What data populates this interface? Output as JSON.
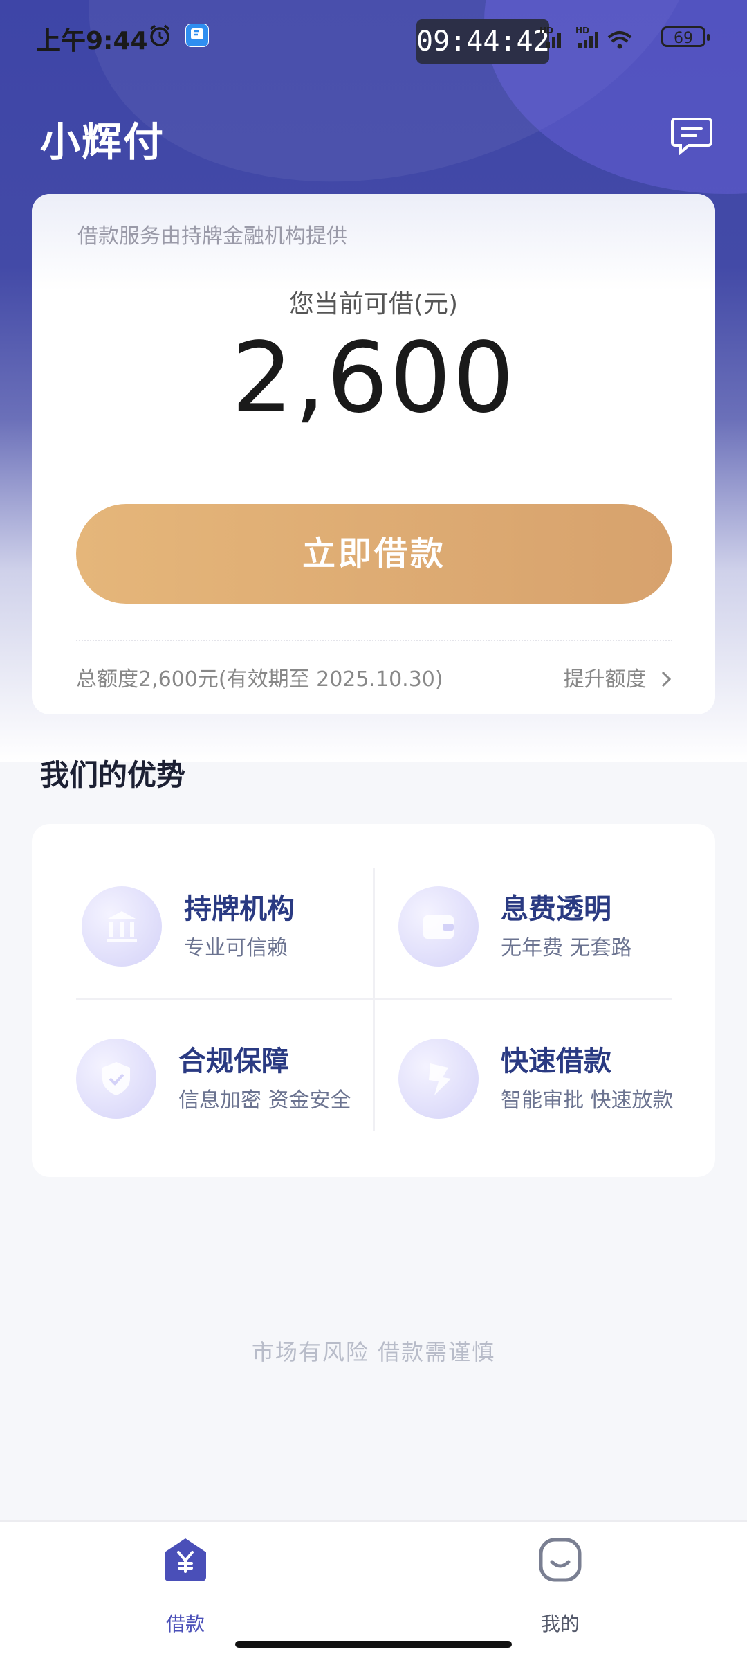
{
  "status_bar": {
    "time": "上午9:44",
    "clock_overlay": "09:44:42",
    "battery": "69"
  },
  "header": {
    "title": "小辉付"
  },
  "loan_card": {
    "provider_note": "借款服务由持牌金融机构提供",
    "available_label": "您当前可借(元)",
    "available_amount": "2,600",
    "borrow_button": "立即借款",
    "quota_text": "总额度2,600元(有效期至 2025.10.30)",
    "raise_quota": "提升额度"
  },
  "advantages": {
    "title": "我们的优势",
    "items": [
      {
        "title": "持牌机构",
        "subtitle": "专业可信赖",
        "icon": "bank-icon"
      },
      {
        "title": "息费透明",
        "subtitle": "无年费 无套路",
        "icon": "wallet-icon"
      },
      {
        "title": "合规保障",
        "subtitle": "信息加密 资金安全",
        "icon": "shield-icon"
      },
      {
        "title": "快速借款",
        "subtitle": "智能审批 快速放款",
        "icon": "lightning-icon"
      }
    ]
  },
  "risk_notice": "市场有风险 借款需谨慎",
  "tabbar": {
    "items": [
      {
        "label": "借款",
        "icon": "yuan-house-icon",
        "active": true
      },
      {
        "label": "我的",
        "icon": "smile-face-icon",
        "active": false
      }
    ]
  },
  "colors": {
    "brand_blue": "#434aa7",
    "button_gold": "#e0ad73",
    "tab_active": "#4a4fb8"
  }
}
